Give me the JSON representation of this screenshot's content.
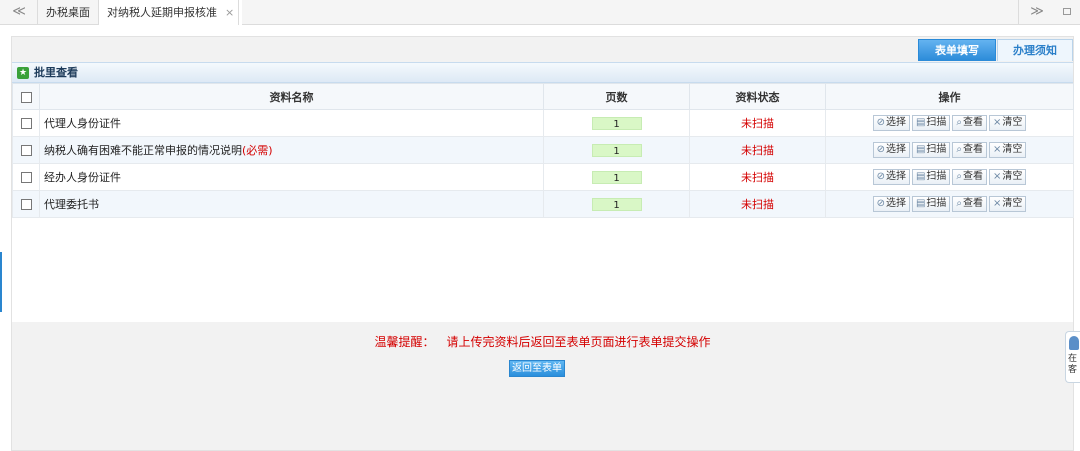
{
  "topbar": {
    "nav_left": "≪",
    "nav_right": "≫",
    "tabs": [
      {
        "label": "办税桌面"
      },
      {
        "label": "对纳税人延期申报核准",
        "close": "×"
      }
    ]
  },
  "right_tabs": [
    {
      "label": "表单填写",
      "active": true
    },
    {
      "label": "办理须知",
      "active": false
    }
  ],
  "panel": {
    "title": "批里查看",
    "columns": [
      "资料名称",
      "页数",
      "资料状态",
      "操作"
    ],
    "rows": [
      {
        "name": "代理人身份证件",
        "required": "",
        "pages": "1",
        "status": "未扫描"
      },
      {
        "name": "纳税人确有困难不能正常申报的情况说明",
        "required": "(必需)",
        "pages": "1",
        "status": "未扫描"
      },
      {
        "name": "经办人身份证件",
        "required": "",
        "pages": "1",
        "status": "未扫描"
      },
      {
        "name": "代理委托书",
        "required": "",
        "pages": "1",
        "status": "未扫描"
      }
    ],
    "ops": {
      "select": "选择",
      "scan": "扫描",
      "view": "查看",
      "clear": "清空"
    }
  },
  "notice": {
    "label": "温馨提醒：",
    "text": "请上传完资料后返回至表单页面进行表单提交操作"
  },
  "return_button": "返回至表单",
  "float_service": {
    "text": "在客"
  },
  "colors": {
    "accent": "#2a8ad8",
    "warning": "#d40000",
    "page_box": "#d9f7c6"
  }
}
